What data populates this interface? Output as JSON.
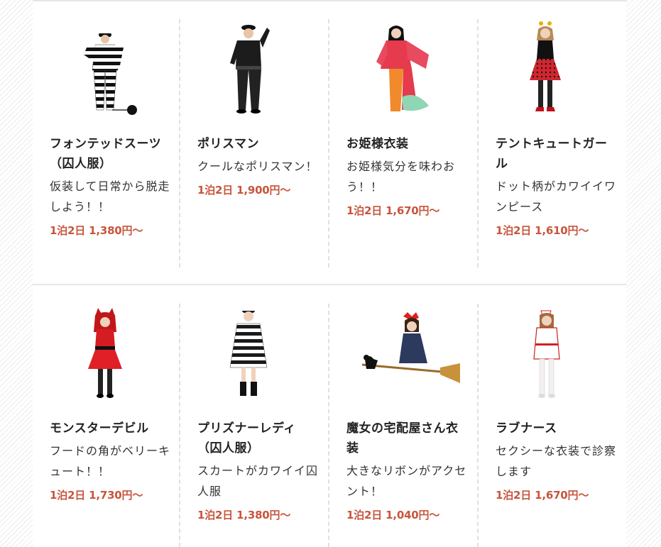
{
  "products": [
    {
      "name": "フォンテッドスーツ（囚人服）",
      "description": "仮装して日常から脱走しよう！！",
      "price": "1泊2日 1,380円～",
      "image": "striped-prisoner-suit-icon"
    },
    {
      "name": "ポリスマン",
      "description": "クールなポリスマン！",
      "price": "1泊2日 1,900円～",
      "image": "police-costume-icon"
    },
    {
      "name": "お姫様衣装",
      "description": "お姫様気分を味わおう！！",
      "price": "1泊2日 1,670円～",
      "image": "princess-kimono-icon"
    },
    {
      "name": "テントキュートガール",
      "description": "ドット柄がカワイイワンピース",
      "price": "1泊2日 1,610円～",
      "image": "polka-dot-dress-icon"
    },
    {
      "name": "モンスターデビル",
      "description": "フードの角がベリーキュート！！",
      "price": "1泊2日 1,730円～",
      "image": "red-devil-dress-icon"
    },
    {
      "name": "プリズナーレディ（囚人服）",
      "description": "スカートがカワイイ囚人服",
      "price": "1泊2日 1,380円～",
      "image": "striped-prisoner-dress-icon"
    },
    {
      "name": "魔女の宅配屋さん衣装",
      "description": "大きなリボンがアクセント！",
      "price": "1泊2日 1,040円～",
      "image": "witch-on-broom-icon"
    },
    {
      "name": "ラブナース",
      "description": "セクシーな衣装で診察します",
      "price": "1泊2日 1,670円～",
      "image": "nurse-costume-icon"
    }
  ]
}
